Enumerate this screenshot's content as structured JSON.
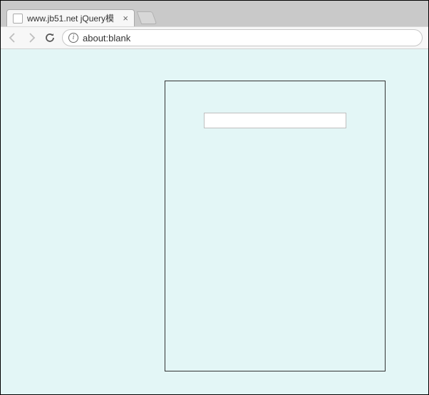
{
  "tab": {
    "title": "www.jb51.net jQuery模",
    "close_glyph": "×"
  },
  "toolbar": {
    "info_glyph": "i",
    "url": "about:blank"
  },
  "page": {
    "input_value": ""
  }
}
